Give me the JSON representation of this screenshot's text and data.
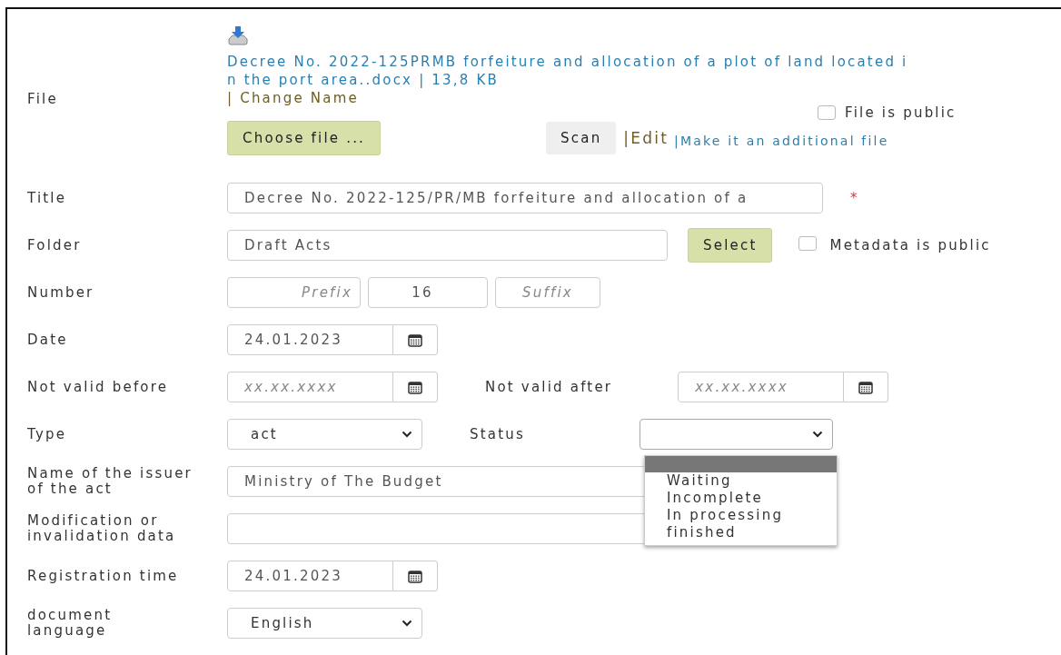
{
  "file": {
    "label": "File",
    "link_lines": [
      "Decree No. 2022-125PRMB forfeiture and allocation of a plot of land located i",
      "n the port area..docx | 13,8 KB"
    ],
    "change_name": "| Change Name",
    "public_checkbox": {
      "label": "File is public",
      "checked": false
    },
    "choose_button": "Choose file ...",
    "scan_button": "Scan",
    "edit_link": "|Edit",
    "additional_link": "|Make it an additional file"
  },
  "rows": [
    {
      "kind": "text",
      "label": "Title",
      "value": "Decree No. 2022-125/PR/MB forfeiture and allocation of a",
      "required_mark": "*"
    },
    {
      "kind": "folder",
      "label": "Folder",
      "value": "Draft Acts",
      "button": "Select",
      "checkbox": {
        "label": "Metadata is public",
        "checked": false
      }
    },
    {
      "kind": "number",
      "label": "Number",
      "prefix_placeholder": "Prefix",
      "value": "16",
      "suffix_placeholder": "Suffix"
    },
    {
      "kind": "date",
      "label": "Date",
      "value": "24.01.2023"
    },
    {
      "kind": "date_pair",
      "label": "Not valid before",
      "placeholder": "xx.xx.xxxx",
      "second_label": "Not valid after",
      "second_placeholder": "xx.xx.xxxx"
    },
    {
      "kind": "select_pair",
      "label": "Type",
      "value": "act",
      "second_label": "Status",
      "dropdown_open": true
    },
    {
      "kind": "text",
      "label": "Name of the issuer\nof the act",
      "value": "Ministry of The Budget"
    },
    {
      "kind": "text",
      "label": "Modification or\ninvalidation data"
    },
    {
      "kind": "date",
      "label": "Registration time",
      "value": "24.01.2023"
    },
    {
      "kind": "select",
      "label": "document\nlanguage",
      "value": "English"
    }
  ],
  "status_dropdown": {
    "blank_highlighted": true,
    "options": [
      {
        "label": "Waiting",
        "selected": false
      },
      {
        "label": "Incomplete",
        "selected": false
      },
      {
        "label": "In processing",
        "selected": false
      },
      {
        "label": "finished",
        "selected": false
      }
    ]
  }
}
